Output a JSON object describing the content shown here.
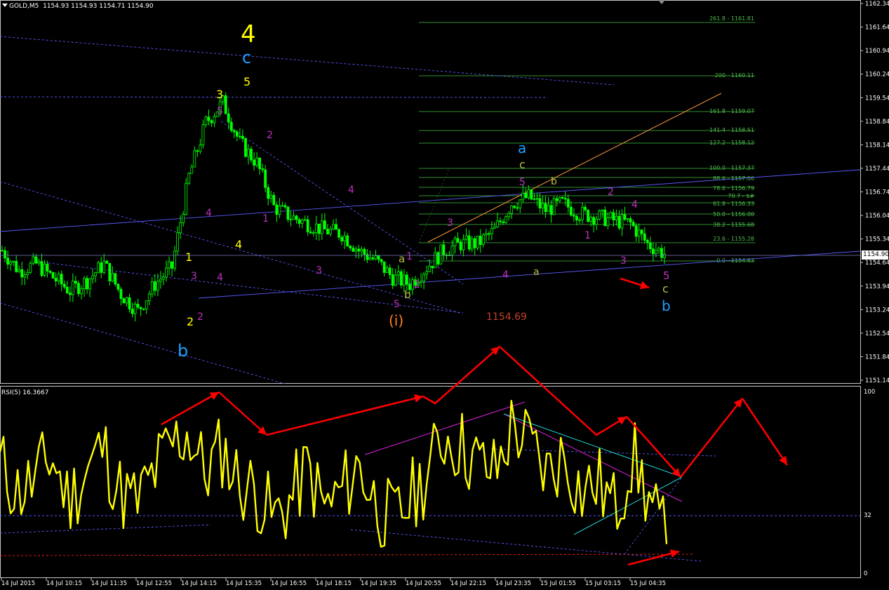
{
  "header": {
    "symbol": "GOLD,M5",
    "ohlc": "1154.93 1154.93 1154.71 1154.90",
    "rsi_label": "RSI(5) 16.3667"
  },
  "price_axis": [
    "1162.34",
    "1161.64",
    "1160.94",
    "1160.24",
    "1159.54",
    "1158.84",
    "1158.14",
    "1157.44",
    "1156.74",
    "1156.04",
    "1155.34",
    "1154.64",
    "1153.94",
    "1153.24",
    "1152.54",
    "1151.84",
    "1151.14"
  ],
  "current_price": "1154.90",
  "rsi_axis": [
    "100",
    "32",
    "0"
  ],
  "time_axis": [
    "14 Jul 2015",
    "14 Jul 10:15",
    "14 Jul 11:35",
    "14 Jul 12:55",
    "14 Jul 14:15",
    "14 Jul 15:35",
    "14 Jul 16:55",
    "14 Jul 18:15",
    "14 Jul 19:35",
    "14 Jul 20:55",
    "14 Jul 22:15",
    "14 Jul 23:35",
    "15 Jul 01:55",
    "15 Jul 03:15",
    "15 Jul 04:35"
  ],
  "fib_levels": [
    "261.8 - 1161.81",
    "200 - 1160.11",
    "161.8 - 1159.07",
    "141.4 - 1158.51",
    "127.2 - 1158.12",
    "100.0 - 1157.37",
    "88.6 - 1157.06",
    "78.6 - 1156.79",
    "70.7 - $#",
    "61.8 - 1156.33",
    "50.0 - 1156.00",
    "38.2 - 1155.68",
    "23.6 - 1155.28",
    "0.0 - 1154.63"
  ],
  "price_annotation": "1154.69",
  "labels": {
    "big4": "4",
    "c_top": "c",
    "five_top": "5",
    "three_top": "3",
    "one_y": "1",
    "two_y": "2",
    "four_y": "4",
    "b_bottom": "b",
    "a_blue": "a",
    "c_olive": "c",
    "five_end": "5",
    "c_end": "c",
    "b_end": "b",
    "paren_i": "(i)",
    "b_olive1": "b",
    "a_olive1": "a",
    "a_olive2": "a",
    "b_olive2": "b"
  },
  "magenta_labels": [
    "5",
    "2",
    "1",
    "4",
    "3",
    "1",
    "2",
    "3",
    "4",
    "5",
    "2",
    "3",
    "5",
    "4",
    "1",
    "2",
    "3",
    "4",
    "4"
  ],
  "colors": {
    "background": "#000000",
    "candles": "#00ff00",
    "fib": "#2f8f2f",
    "rsi_line": "#ffff00",
    "arrows": "#ff0000",
    "trend_blue": "#5a5aff",
    "magenta": "#c030c0",
    "yellow_label": "#ffff00",
    "cyan_label": "#20a0ff",
    "olive_label": "#b5c040",
    "orange_label": "#ff8020"
  },
  "chart_data": {
    "type": "line",
    "title": "GOLD,M5",
    "xlabel": "",
    "ylabel": "",
    "ylim": [
      1151.14,
      1162.34
    ],
    "series": [
      {
        "name": "GOLD,M5",
        "values": [
          1155.0,
          1154.4,
          1154.6,
          1154.2,
          1153.8,
          1154.1,
          1154.6,
          1153.7,
          1153.2,
          1154.0,
          1154.5,
          1157.2,
          1158.8,
          1159.4,
          1158.2,
          1157.6,
          1156.3,
          1156.0,
          1155.8,
          1155.6,
          1155.5,
          1155.0,
          1154.7,
          1154.2,
          1154.0,
          1154.5,
          1155.0,
          1155.2,
          1155.2,
          1155.6,
          1156.4,
          1156.6,
          1156.2,
          1156.4,
          1156.1,
          1156.0,
          1155.9,
          1155.8,
          1155.2,
          1154.9
        ]
      },
      {
        "name": "RSI(5) 16.3667",
        "values": [
          60,
          45,
          50,
          65,
          40,
          55,
          70,
          45,
          38,
          55,
          70,
          78,
          55,
          68,
          50,
          45,
          30,
          40,
          58,
          35,
          45,
          60,
          38,
          28,
          40,
          55,
          76,
          70,
          60,
          55,
          82,
          70,
          55,
          65,
          45,
          50,
          35,
          65,
          40,
          16
        ]
      }
    ],
    "rsi_ylim": [
      0,
      100
    ],
    "rsi_level": 32
  }
}
